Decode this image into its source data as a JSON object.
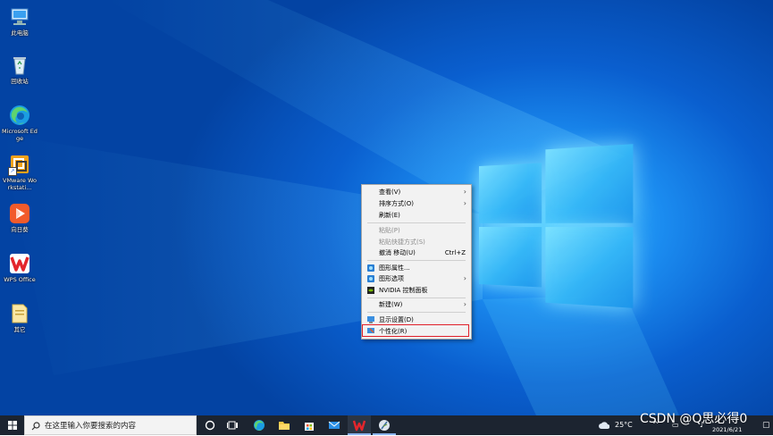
{
  "desktop": {
    "icons": [
      {
        "label": "此电脑",
        "icon": "computer-icon"
      },
      {
        "label": "回收站",
        "icon": "recycle-bin-icon"
      },
      {
        "label": "Microsoft Edge",
        "icon": "edge-icon"
      },
      {
        "label": "VMware Workstati...",
        "icon": "vmware-icon"
      },
      {
        "label": "向日葵",
        "icon": "sunlogin-icon"
      },
      {
        "label": "WPS Office",
        "icon": "wps-icon"
      },
      {
        "label": "其它",
        "icon": "folder-icon"
      }
    ]
  },
  "context_menu": {
    "items": [
      {
        "label": "查看(V)",
        "submenu": true
      },
      {
        "label": "排序方式(O)",
        "submenu": true
      },
      {
        "label": "刷新(E)"
      },
      {
        "label": "粘贴(P)",
        "disabled": true
      },
      {
        "label": "粘贴快捷方式(S)",
        "disabled": true
      },
      {
        "label": "撤消 移动(U)",
        "shortcut": "Ctrl+Z"
      },
      {
        "label": "图形属性...",
        "icon": "graphics-icon"
      },
      {
        "label": "图形选项",
        "icon": "graphics-icon",
        "submenu": true
      },
      {
        "label": "NVIDIA 控制面板",
        "icon": "nvidia-icon"
      },
      {
        "label": "新建(W)",
        "submenu": true
      },
      {
        "label": "显示设置(D)",
        "icon": "display-icon"
      },
      {
        "label": "个性化(R)",
        "icon": "personalize-icon",
        "highlighted": true
      }
    ],
    "submenu_arrow": "›"
  },
  "taskbar": {
    "search_placeholder": "在这里输入你要搜索的内容",
    "apps": [
      "cortana-icon",
      "task-view-icon",
      "edge-icon",
      "file-explorer-icon",
      "store-icon",
      "mail-icon",
      "wps-icon",
      "feather-icon"
    ],
    "weather": "25°C",
    "date": "2021/6/21"
  },
  "watermark": "CSDN @Q思必得0",
  "colors": {
    "highlight_border": "#e0202a",
    "taskbar": "#1c2430",
    "menu_bg": "#f2f2f2"
  }
}
